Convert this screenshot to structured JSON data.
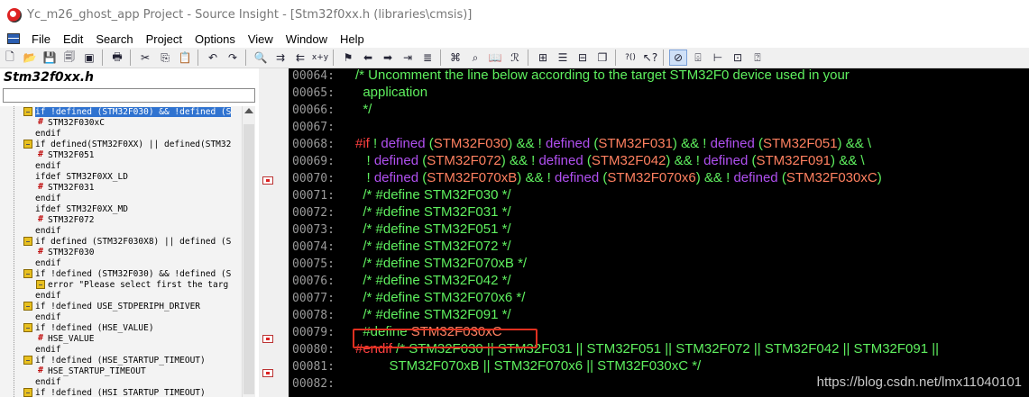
{
  "window": {
    "title": "Yc_m26_ghost_app Project - Source Insight - [Stm32f0xx.h (libraries\\cmsis)]"
  },
  "menu": [
    "File",
    "Edit",
    "Search",
    "Project",
    "Options",
    "View",
    "Window",
    "Help"
  ],
  "toolbar": {
    "icons": [
      "new-file-icon",
      "open-file-icon",
      "save-icon",
      "save-all-icon",
      "close-icon",
      "sep",
      "print-icon",
      "sep",
      "cut-icon",
      "copy-icon",
      "paste-icon",
      "sep",
      "undo-icon",
      "redo-icon",
      "sep",
      "find-icon",
      "find-next-icon",
      "find-prev-icon",
      "replace-icon",
      "sep",
      "bookmark-icon",
      "back-icon",
      "forward-icon",
      "jump-icon",
      "jump-def-icon",
      "sep",
      "browse-icon",
      "lookup-icon",
      "book-icon",
      "relation-icon",
      "sep",
      "window-tile-icon",
      "window-list-icon",
      "window-split-icon",
      "window-cascade-icon",
      "sep",
      "help-context-icon",
      "pointer-help-icon",
      "sep",
      "link-icon",
      "view-icon",
      "tree-icon",
      "split-icon",
      "help-icon"
    ],
    "glyphs": {
      "x_y": "x+y",
      "context_help": "?()"
    }
  },
  "symbol_window": {
    "file_title": "Stm32f0xx.h",
    "filter_value": "",
    "items": [
      {
        "type": "cond",
        "indent": 1,
        "text": "if !defined (STM32F030) && !defined (S",
        "selected": true
      },
      {
        "type": "def",
        "indent": 2,
        "text": "STM32F030xC"
      },
      {
        "type": "none",
        "indent": 1,
        "text": "endif"
      },
      {
        "type": "cond",
        "indent": 1,
        "text": "if defined(STM32F0XX) || defined(STM32"
      },
      {
        "type": "def",
        "indent": 2,
        "text": "STM32F051"
      },
      {
        "type": "none",
        "indent": 1,
        "text": "endif"
      },
      {
        "type": "none",
        "indent": 1,
        "text": "ifdef STM32F0XX_LD"
      },
      {
        "type": "def",
        "indent": 2,
        "text": "STM32F031"
      },
      {
        "type": "none",
        "indent": 1,
        "text": "endif"
      },
      {
        "type": "none",
        "indent": 1,
        "text": "ifdef STM32F0XX_MD"
      },
      {
        "type": "def",
        "indent": 2,
        "text": "STM32F072"
      },
      {
        "type": "none",
        "indent": 1,
        "text": "endif"
      },
      {
        "type": "cond",
        "indent": 1,
        "text": "if defined (STM32F030X8) || defined (S"
      },
      {
        "type": "def",
        "indent": 2,
        "text": "STM32F030"
      },
      {
        "type": "none",
        "indent": 1,
        "text": "endif"
      },
      {
        "type": "cond",
        "indent": 1,
        "text": "if !defined (STM32F030) && !defined (S"
      },
      {
        "type": "cond",
        "indent": 2,
        "text": "error \"Please select first the targ"
      },
      {
        "type": "none",
        "indent": 1,
        "text": "endif"
      },
      {
        "type": "cond",
        "indent": 1,
        "text": "if !defined USE_STDPERIPH_DRIVER"
      },
      {
        "type": "none",
        "indent": 1,
        "text": "endif"
      },
      {
        "type": "cond",
        "indent": 1,
        "text": "if !defined  (HSE_VALUE)"
      },
      {
        "type": "def",
        "indent": 2,
        "text": "HSE_VALUE"
      },
      {
        "type": "none",
        "indent": 1,
        "text": "endif"
      },
      {
        "type": "cond",
        "indent": 1,
        "text": "if !defined  (HSE_STARTUP_TIMEOUT)"
      },
      {
        "type": "def",
        "indent": 2,
        "text": "HSE_STARTUP_TIMEOUT"
      },
      {
        "type": "none",
        "indent": 1,
        "text": "endif"
      },
      {
        "type": "cond",
        "indent": 1,
        "text": "if !defined  (HSI_STARTUP_TIMEOUT)"
      }
    ]
  },
  "editor": {
    "lines": [
      {
        "num": "00064:",
        "segs": [
          [
            "c-comment",
            "/* Uncomment the line below according to the target STM32F0 device used in your"
          ]
        ]
      },
      {
        "num": "00065:",
        "segs": [
          [
            "c-comment",
            "  application"
          ]
        ]
      },
      {
        "num": "00066:",
        "segs": [
          [
            "c-comment",
            "  */"
          ]
        ]
      },
      {
        "num": "00067:",
        "segs": []
      },
      {
        "num": "00068:",
        "segs": [
          [
            "c-kw",
            "#if"
          ],
          [
            "c-op",
            " ! "
          ],
          [
            "c-fn",
            "defined"
          ],
          [
            "c-op",
            " ("
          ],
          [
            "c-mac",
            "STM32F030"
          ],
          [
            "c-op",
            ") && ! "
          ],
          [
            "c-fn",
            "defined"
          ],
          [
            "c-op",
            " ("
          ],
          [
            "c-mac",
            "STM32F031"
          ],
          [
            "c-op",
            ") && ! "
          ],
          [
            "c-fn",
            "defined"
          ],
          [
            "c-op",
            " ("
          ],
          [
            "c-mac",
            "STM32F051"
          ],
          [
            "c-op",
            ") && \\"
          ]
        ]
      },
      {
        "num": "00069:",
        "segs": [
          [
            "c-op",
            "   ! "
          ],
          [
            "c-fn",
            "defined"
          ],
          [
            "c-op",
            " ("
          ],
          [
            "c-mac",
            "STM32F072"
          ],
          [
            "c-op",
            ") && ! "
          ],
          [
            "c-fn",
            "defined"
          ],
          [
            "c-op",
            " ("
          ],
          [
            "c-mac",
            "STM32F042"
          ],
          [
            "c-op",
            ") && ! "
          ],
          [
            "c-fn",
            "defined"
          ],
          [
            "c-op",
            " ("
          ],
          [
            "c-mac",
            "STM32F091"
          ],
          [
            "c-op",
            ") && \\"
          ]
        ]
      },
      {
        "num": "00070:",
        "segs": [
          [
            "c-op",
            "   ! "
          ],
          [
            "c-fn",
            "defined"
          ],
          [
            "c-op",
            " ("
          ],
          [
            "c-mac",
            "STM32F070xB"
          ],
          [
            "c-op",
            ") && ! "
          ],
          [
            "c-fn",
            "defined"
          ],
          [
            "c-op",
            " ("
          ],
          [
            "c-mac",
            "STM32F070x6"
          ],
          [
            "c-op",
            ") && ! "
          ],
          [
            "c-fn",
            "defined"
          ],
          [
            "c-op",
            " ("
          ],
          [
            "c-mac",
            "STM32F030xC"
          ],
          [
            "c-op",
            ")"
          ]
        ]
      },
      {
        "num": "00071:",
        "segs": [
          [
            "c-comment",
            "  /* #define STM32F030 */"
          ]
        ]
      },
      {
        "num": "00072:",
        "segs": [
          [
            "c-comment",
            "  /* #define STM32F031 */"
          ]
        ]
      },
      {
        "num": "00073:",
        "segs": [
          [
            "c-comment",
            "  /* #define STM32F051 */"
          ]
        ]
      },
      {
        "num": "00074:",
        "segs": [
          [
            "c-comment",
            "  /* #define STM32F072 */"
          ]
        ]
      },
      {
        "num": "00075:",
        "segs": [
          [
            "c-comment",
            "  /* #define STM32F070xB */"
          ]
        ]
      },
      {
        "num": "00076:",
        "segs": [
          [
            "c-comment",
            "  /* #define STM32F042 */"
          ]
        ]
      },
      {
        "num": "00077:",
        "segs": [
          [
            "c-comment",
            "  /* #define STM32F070x6 */"
          ]
        ]
      },
      {
        "num": "00078:",
        "segs": [
          [
            "c-comment",
            "  /* #define STM32F091 */"
          ]
        ]
      },
      {
        "num": "00079:",
        "segs": [
          [
            "c-def",
            "  #define "
          ],
          [
            "c-mac",
            "STM32F030xC"
          ]
        ]
      },
      {
        "num": "00080:",
        "segs": [
          [
            "c-kw",
            "#endif"
          ],
          [
            "c-comment",
            " /* STM32F030 || STM32F031 || STM32F051 || STM32F072 || STM32F042 || STM32F091 ||"
          ]
        ]
      },
      {
        "num": "00081:",
        "segs": [
          [
            "c-comment",
            "         STM32F070xB || STM32F070x6 || STM32F030xC */"
          ]
        ]
      },
      {
        "num": "00082:",
        "segs": []
      }
    ]
  },
  "watermark": "https://blog.csdn.net/lmx11040101",
  "colors": {
    "editor_bg": "#000000",
    "comment": "#5ff05f",
    "keyword": "#ff4040",
    "function": "#b050f0",
    "macro": "#ff8060",
    "selection": "#3073d0",
    "highlight_box": "#e03020"
  }
}
